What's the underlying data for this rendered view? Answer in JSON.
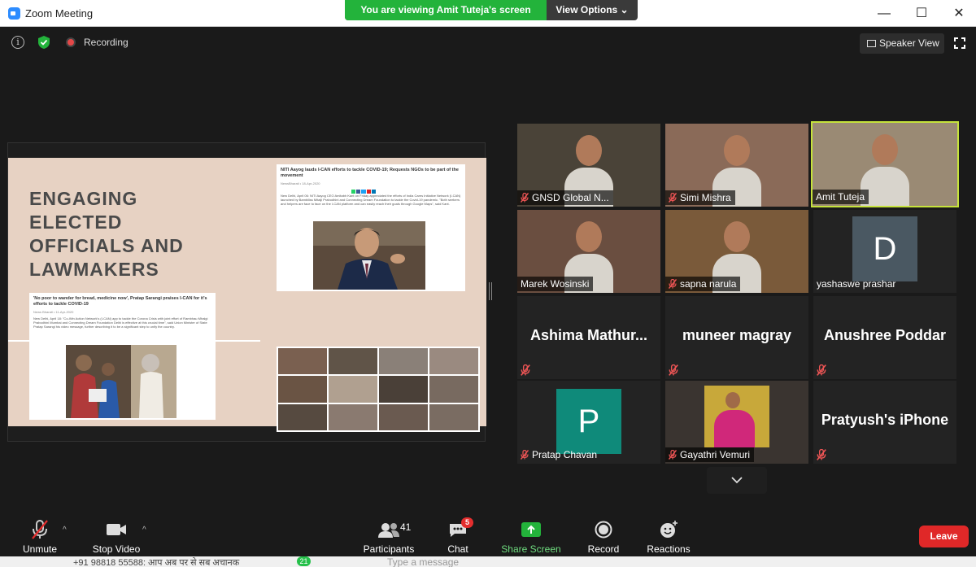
{
  "window": {
    "title": "Zoom Meeting",
    "viewing_banner": "You are viewing Amit Tuteja's screen",
    "view_options": "View Options ⌄",
    "minimize": "—",
    "maximize": "☐",
    "close": "✕"
  },
  "topbar": {
    "info": "i",
    "recording_label": "Recording",
    "speaker_view_label": "Speaker View"
  },
  "slide": {
    "heading_lines": [
      "ENGAGING",
      "ELECTED",
      "OFFICIALS AND",
      "LAWMAKERS"
    ],
    "article_right_title": "NITI Aayog lauds I-CAN efforts to tackle COVID-19; Requests NGOs to be part of the movement",
    "article_right_meta": "NewsBharati  •  18-Apr-2020",
    "article_right_body": "New Delhi, April 06: NITI Aayog CEO Amitabh Kant on Friday appreciated the efforts of India Cares Initiative Network (I-CAN) launched by Bambiliss Mitalji Prabodhini and Connecting Dream Foundation to tackle the Covid-19 pandemic. \"Both seekers and helpers are face to face on the I-CAN platform and can easily reach their goals through Google Maps\", said Kant.",
    "article_left_title": "'No poor to wander for bread, medicine now', Pratap Sarangi praises I-CAN for it's efforts to tackle COVID-19",
    "article_left_meta": "News Bharati  •  11-Apr-2020",
    "article_left_body": "New Delhi, April 18: \"Co-Win Action Network's (I-CAN) app to tackle the Corona Crisis with joint effort of Rambhau Mhalgi Prabodhini Mumbai and Connecting Dream Foundation Delhi is effective at this crucial time\", said Union Minister of State Pratap Sarangi his video message, further describing it to be a significant step to unify the country."
  },
  "participants_grid": [
    {
      "name": "GNSD Global N...",
      "muted": true,
      "type": "video",
      "bg": "#4a4338"
    },
    {
      "name": "Simi Mishra",
      "muted": true,
      "type": "video",
      "bg": "#8a6a58"
    },
    {
      "name": "Amit Tuteja",
      "muted": false,
      "type": "video",
      "active": true,
      "bg": "#9a8a74"
    },
    {
      "name": "Marek Wosinski",
      "muted": false,
      "type": "video",
      "bg": "#6a4e40"
    },
    {
      "name": "sapna narula",
      "muted": true,
      "type": "video",
      "bg": "#7a5a3a"
    },
    {
      "name": "yashaswe prashar",
      "muted": false,
      "type": "letter",
      "letter": "D",
      "avatar_color": "#4a5862"
    },
    {
      "name": "Ashima  Mathur...",
      "muted": true,
      "type": "name"
    },
    {
      "name": "muneer magray",
      "muted": true,
      "type": "name"
    },
    {
      "name": "Anushree Poddar",
      "muted": true,
      "type": "name"
    },
    {
      "name": "Pratap Chavan",
      "muted": true,
      "type": "letter",
      "letter": "P",
      "avatar_color": "#0f8a7a"
    },
    {
      "name": "Gayathri Vemuri",
      "muted": true,
      "type": "photo",
      "bg": "#3a3430"
    },
    {
      "name": "Pratyush's iPhone",
      "muted": true,
      "type": "name"
    }
  ],
  "toolbar": {
    "unmute": "Unmute",
    "stop_video": "Stop Video",
    "participants": "Participants",
    "participants_count": "41",
    "chat": "Chat",
    "chat_badge": "5",
    "share_screen": "Share Screen",
    "record": "Record",
    "reactions": "Reactions",
    "leave": "Leave"
  },
  "background_app": {
    "left_text": "+91 98818 55588: आप अब पर से सब अचानक",
    "badge": "21",
    "message_placeholder": "Type a message"
  },
  "colors": {
    "share_green": "#23b33b",
    "leave_red": "#e02828",
    "active_speaker": "#c6e33b",
    "slide_bg": "#e7d2c3"
  }
}
